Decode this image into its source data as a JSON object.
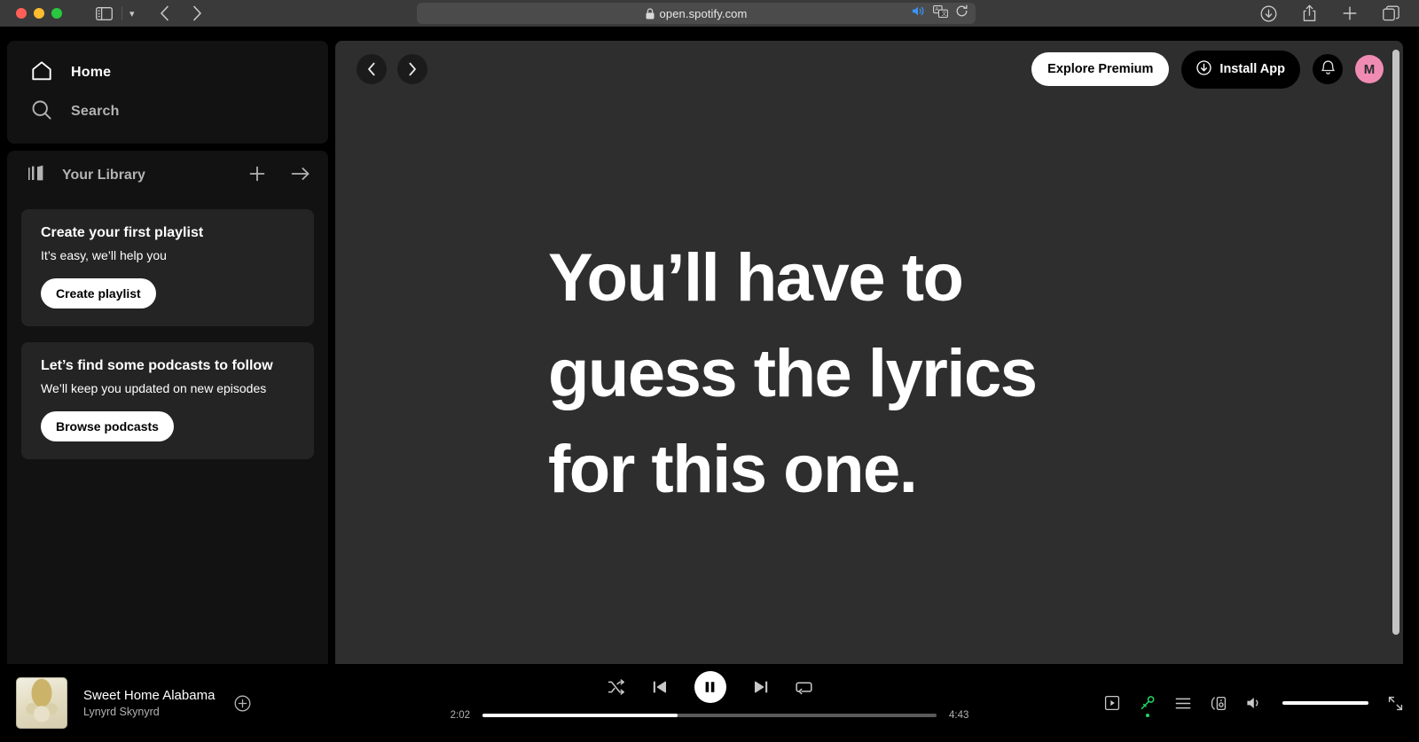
{
  "browser": {
    "url": "open.spotify.com",
    "icons": {
      "sidebar_toggle": "sidebar-toggle-icon",
      "tab_chevron": "chevron-down-icon",
      "back": "back-chevron-icon",
      "forward": "forward-chevron-icon",
      "lock": "lock-icon",
      "audio": "speaker-playing-icon",
      "translate": "translate-icon",
      "reload": "reload-icon",
      "downloads": "download-circle-icon",
      "share": "share-icon",
      "new_tab": "plus-icon",
      "tab_overview": "tab-overview-icon"
    },
    "traffic_lights": [
      "close",
      "minimize",
      "zoom"
    ]
  },
  "sidebar": {
    "nav_items": [
      {
        "label": "Home",
        "icon": "home-icon",
        "active": true
      },
      {
        "label": "Search",
        "icon": "search-icon",
        "active": false
      }
    ],
    "library": {
      "title": "Your Library",
      "icon": "library-icon",
      "add_icon": "plus-icon",
      "expand_icon": "arrow-right-icon"
    },
    "promos": [
      {
        "title": "Create your first playlist",
        "subtitle": "It’s easy, we’ll help you",
        "button": "Create playlist"
      },
      {
        "title": "Let’s find some podcasts to follow",
        "subtitle": "We’ll keep you updated on new episodes",
        "button": "Browse podcasts"
      }
    ]
  },
  "main": {
    "nav_back_icon": "chevron-left-icon",
    "nav_forward_icon": "chevron-right-icon",
    "explore_premium": "Explore Premium",
    "install_app": "Install App",
    "install_app_icon": "download-circle-icon",
    "notifications_icon": "bell-icon",
    "avatar_initial": "M",
    "avatar_color": "#f08cb4",
    "lyrics": [
      "You’ll have to",
      "guess the lyrics",
      "for this one."
    ]
  },
  "player": {
    "track_title": "Sweet Home Alabama",
    "track_artist": "Lynyrd Skynyrd",
    "add_icon": "plus-circle-icon",
    "album_art": "album-cover-sweet-home-alabama",
    "controls": {
      "shuffle": "shuffle-icon",
      "previous": "previous-track-icon",
      "play_pause": "pause-icon",
      "next": "next-track-icon",
      "repeat": "repeat-icon"
    },
    "time_elapsed": "2:02",
    "time_total": "4:43",
    "progress_percent": 43,
    "right_controls": [
      {
        "name": "now-playing-view-icon",
        "active": false
      },
      {
        "name": "lyrics-microphone-icon",
        "active": true
      },
      {
        "name": "queue-icon",
        "active": false
      },
      {
        "name": "connect-to-device-icon",
        "active": false
      },
      {
        "name": "volume-icon",
        "active": false
      }
    ],
    "volume_percent": 100,
    "fullscreen_icon": "fullscreen-icon",
    "accent_color": "#1ed760"
  }
}
